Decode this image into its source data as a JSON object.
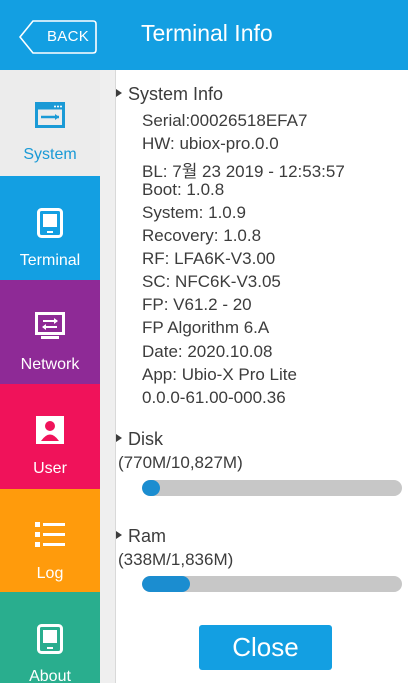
{
  "header": {
    "back_label": "BACK",
    "title": "Terminal Info"
  },
  "sidebar": {
    "items": [
      {
        "label": "System",
        "icon": "system-icon",
        "color": "#ececec",
        "text_color": "#1a9ad6",
        "selected": true
      },
      {
        "label": "Terminal",
        "icon": "terminal-icon",
        "color": "#139fe2",
        "text_color": "#ffffff",
        "selected": false
      },
      {
        "label": "Network",
        "icon": "network-icon",
        "color": "#8e2a96",
        "text_color": "#ffffff",
        "selected": false
      },
      {
        "label": "User",
        "icon": "user-icon",
        "color": "#f0125a",
        "text_color": "#ffffff",
        "selected": false
      },
      {
        "label": "Log",
        "icon": "log-icon",
        "color": "#ff9b0c",
        "text_color": "#ffffff",
        "selected": false
      },
      {
        "label": "About",
        "icon": "about-icon",
        "color": "#29ae8e",
        "text_color": "#ffffff",
        "selected": false
      }
    ]
  },
  "system_info": {
    "heading": "System Info",
    "lines": [
      "Serial:00026518EFA7",
      "HW: ubiox-pro.0.0",
      "BL:  7월 23 2019 - 12:53:57",
      "Boot: 1.0.8",
      "System: 1.0.9",
      "Recovery: 1.0.8",
      "RF: LFA6K-V3.00",
      "SC: NFC6K-V3.05",
      "FP: V61.2 - 20",
      "FP Algorithm 6.A",
      "Date: 2020.10.08",
      "App: Ubio-X Pro Lite",
      "0.0.0-61.00-000.36"
    ]
  },
  "disk": {
    "heading": "Disk",
    "usage": "(770M/10,827M)",
    "used_fraction": 0.071
  },
  "ram": {
    "heading": "Ram",
    "usage": "(338M/1,836M)",
    "used_fraction": 0.184
  },
  "close_label": "Close",
  "colors": {
    "accent": "#139fe2",
    "bar_fill": "#1b8dd0",
    "bar_track": "#c7c7c7"
  }
}
